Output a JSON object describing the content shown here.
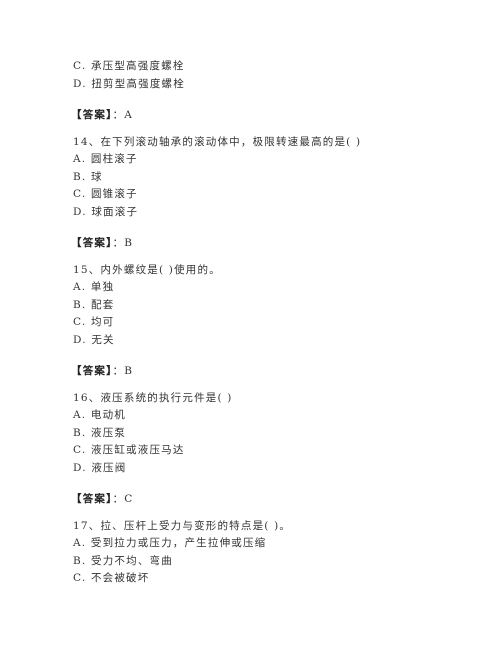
{
  "document": {
    "leading_options": [
      {
        "label": "C.",
        "text": "承压型高强度螺栓"
      },
      {
        "label": "D.",
        "text": "扭剪型高强度螺栓"
      }
    ],
    "leading_answer": {
      "prefix": "【答案】",
      "sep": "：",
      "value": "A"
    },
    "questions": [
      {
        "number": "14、",
        "stem": "在下列滚动轴承的滚动体中，极限转速最高的是(    )",
        "options": [
          {
            "label": "A.",
            "text": "圆柱滚子"
          },
          {
            "label": "B.",
            "text": "球"
          },
          {
            "label": "C.",
            "text": "圆锥滚子"
          },
          {
            "label": "D.",
            "text": "球面滚子"
          }
        ],
        "answer": {
          "prefix": "【答案】",
          "sep": "：",
          "value": "B"
        }
      },
      {
        "number": "15、",
        "stem": "内外螺纹是(    )使用的。",
        "options": [
          {
            "label": "A.",
            "text": "单独"
          },
          {
            "label": "B.",
            "text": "配套"
          },
          {
            "label": "C.",
            "text": "均可"
          },
          {
            "label": "D.",
            "text": "无关"
          }
        ],
        "answer": {
          "prefix": "【答案】",
          "sep": "：",
          "value": "B"
        }
      },
      {
        "number": "16、",
        "stem": "液压系统的执行元件是(    )",
        "options": [
          {
            "label": "A.",
            "text": "电动机"
          },
          {
            "label": "B.",
            "text": "液压泵"
          },
          {
            "label": "C.",
            "text": "液压缸或液压马达"
          },
          {
            "label": "D.",
            "text": "液压阀"
          }
        ],
        "answer": {
          "prefix": "【答案】",
          "sep": "：",
          "value": "C"
        }
      },
      {
        "number": "17、",
        "stem": "拉、压杆上受力与变形的特点是(    )。",
        "options": [
          {
            "label": "A.",
            "text": "受到拉力或压力，产生拉伸或压缩"
          },
          {
            "label": "B.",
            "text": "受力不均、弯曲"
          },
          {
            "label": "C.",
            "text": "不会被破坏"
          }
        ]
      }
    ]
  }
}
